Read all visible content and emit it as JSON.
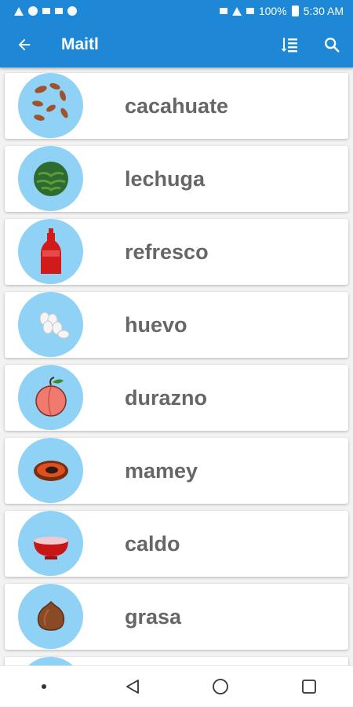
{
  "status": {
    "battery_percent": "100%",
    "time": "5:30 AM"
  },
  "toolbar": {
    "title": "Maitl"
  },
  "items": [
    {
      "label": "cacahuate",
      "icon": "peanuts-icon"
    },
    {
      "label": "lechuga",
      "icon": "lettuce-icon"
    },
    {
      "label": "refresco",
      "icon": "soda-bottle-icon"
    },
    {
      "label": "huevo",
      "icon": "eggs-icon"
    },
    {
      "label": "durazno",
      "icon": "peach-icon"
    },
    {
      "label": "mamey",
      "icon": "mamey-icon"
    },
    {
      "label": "caldo",
      "icon": "broth-bowl-icon"
    },
    {
      "label": "grasa",
      "icon": "lard-icon"
    }
  ],
  "colors": {
    "primary": "#1e88d6",
    "thumb_background": "#8fd2f6",
    "label_text": "#666666"
  }
}
